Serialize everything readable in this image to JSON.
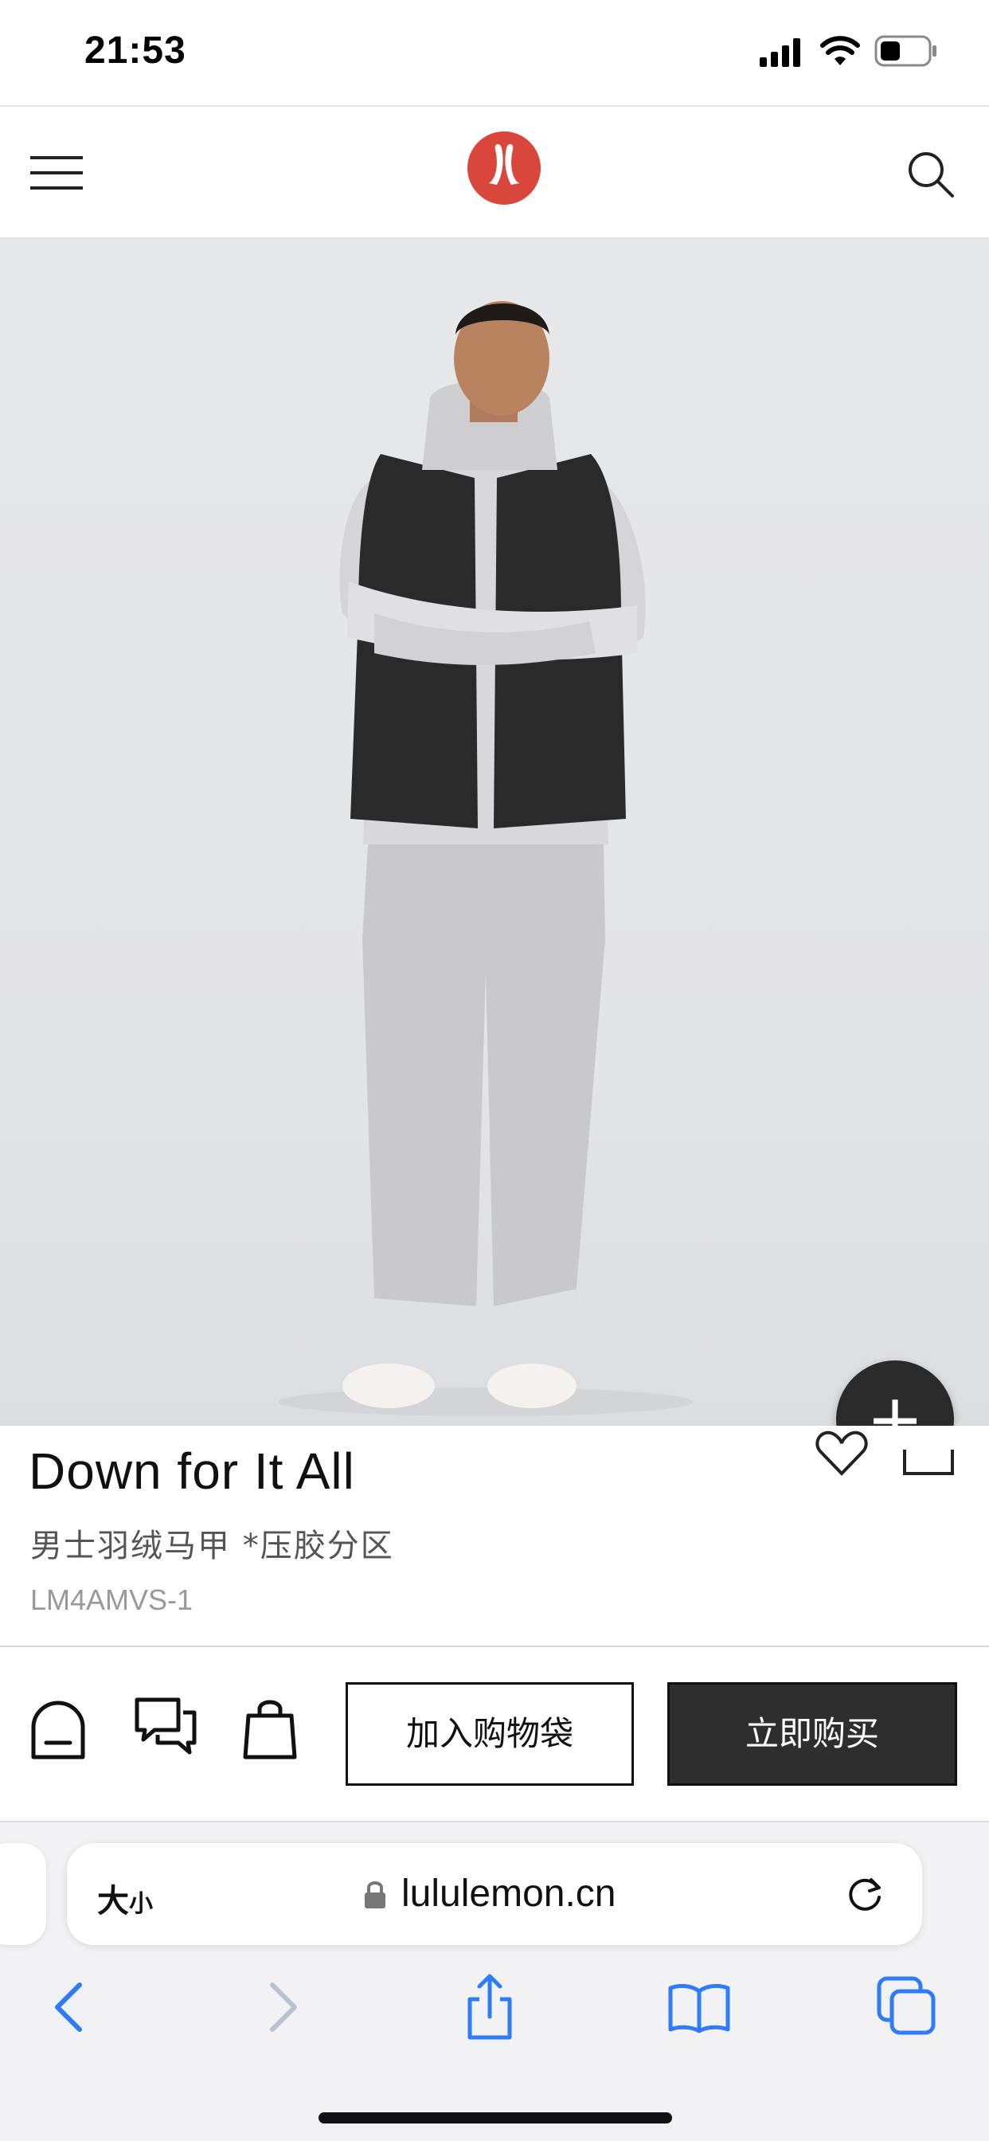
{
  "status_bar": {
    "time": "21:53",
    "battery_level": 0.4
  },
  "header": {
    "menu_icon": "hamburger-menu-icon",
    "logo_icon": "lululemon-logo",
    "search_icon": "search-icon"
  },
  "product": {
    "title": "Down for It All",
    "subtitle": "男士羽绒马甲 *压胶分区",
    "sku": "LM4AMVS-1",
    "fab_label": "+"
  },
  "actions": {
    "add_to_bag_label": "加入购物袋",
    "buy_now_label": "立即购买",
    "home_icon": "home-icon",
    "chat_icon": "chat-icon",
    "bag_icon": "shopping-bag-icon"
  },
  "safari": {
    "text_size_big": "大",
    "text_size_small": "小",
    "url": "lululemon.cn"
  },
  "colors": {
    "brand_red": "#d9463c",
    "dark_button": "#2e2e2e",
    "safari_blue": "#2f7cf6"
  }
}
